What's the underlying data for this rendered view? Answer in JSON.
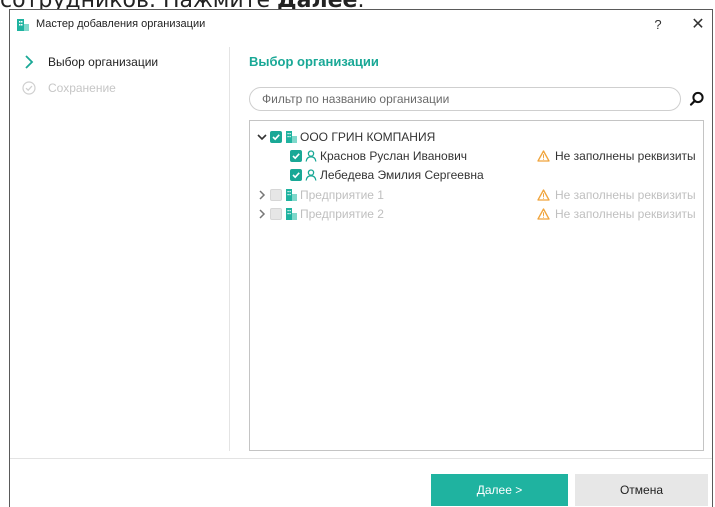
{
  "background_text": {
    "prefix": "сотрудников. Нажмите ",
    "bold": "Далее",
    "suffix": "."
  },
  "window": {
    "title": "Мастер добавления организации",
    "help_glyph": "?",
    "close_glyph": "✕"
  },
  "steps": [
    {
      "label": "Выбор организации",
      "state": "active"
    },
    {
      "label": "Сохранение",
      "state": "inactive"
    }
  ],
  "main": {
    "heading": "Выбор организации",
    "search": {
      "placeholder": "Фильтр по названию организации",
      "value": "",
      "icon": "search-icon"
    }
  },
  "tree": [
    {
      "label": "ООО ГРИН КОМПАНИЯ",
      "type": "organization",
      "expanded": true,
      "checked": true,
      "enabled": true,
      "warning": ""
    },
    {
      "label": "Краснов  Руслан  Иванович",
      "type": "employee",
      "checked": true,
      "enabled": true,
      "warning": "Не заполнены реквизиты"
    },
    {
      "label": "Лебедева  Эмилия  Сергеевна",
      "type": "employee",
      "checked": true,
      "enabled": true,
      "warning": ""
    },
    {
      "label": "Предприятие 1",
      "type": "organization",
      "expanded": false,
      "checked": false,
      "enabled": false,
      "warning": "Не заполнены реквизиты"
    },
    {
      "label": "Предприятие 2",
      "type": "organization",
      "expanded": false,
      "checked": false,
      "enabled": false,
      "warning": "Не заполнены реквизиты"
    }
  ],
  "buttons": {
    "next": "Далее >",
    "cancel": "Отмена"
  },
  "colors": {
    "accent": "#19a896",
    "button_primary": "#1fb3a0",
    "warning": "#f0a43c",
    "disabled": "#bfbfbf"
  }
}
